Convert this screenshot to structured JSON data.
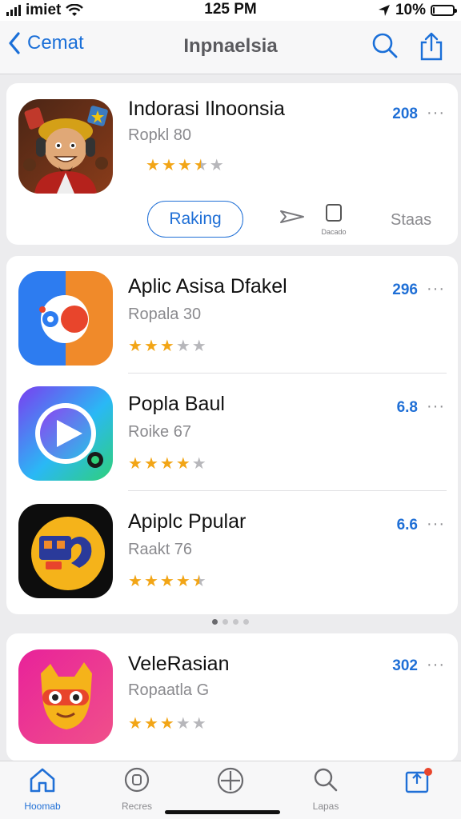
{
  "status_bar": {
    "carrier": "imiet",
    "time": "125 PM",
    "battery": "10%",
    "battery_level": 0.1
  },
  "nav": {
    "back_label": "Cemat",
    "title": "Inpnaelsia"
  },
  "featured": {
    "name": "Indorasi Ilnoonsia",
    "subtitle": "Ropkl 80",
    "rating": 3.5,
    "count": "208",
    "more": "···",
    "button_label": "Raking",
    "action_label": "Dacado",
    "stats_label": "Staas"
  },
  "apps": [
    {
      "name": "Aplic Asisa Dfakel",
      "subtitle": "Ropala 30",
      "rating": 3,
      "count": "296",
      "more": "···"
    },
    {
      "name": "Popla Baul",
      "subtitle": "Roike 67",
      "rating": 4,
      "count": "6.8",
      "more": "···"
    },
    {
      "name": "Apiplc Ppular",
      "subtitle": "Raakt 76",
      "rating": 4.5,
      "count": "6.6",
      "more": "···"
    }
  ],
  "bottom_app": {
    "name": "VeleRasian",
    "subtitle": "Ropaatla G",
    "rating": 3,
    "count": "302",
    "more": "···"
  },
  "page_dots": {
    "count": 4,
    "active": 0
  },
  "tabs": [
    {
      "label": "Hoomab",
      "icon": "home-icon",
      "active": true
    },
    {
      "label": "Recres",
      "icon": "badge-icon",
      "active": false
    },
    {
      "label": "",
      "icon": "plus-circle-icon",
      "active": false
    },
    {
      "label": "Lapas",
      "icon": "search-icon",
      "active": false
    },
    {
      "label": "",
      "icon": "updates-icon",
      "active": false
    }
  ],
  "colors": {
    "accent": "#1f6fd6",
    "star": "#f2a516",
    "badge": "#e8452c"
  }
}
